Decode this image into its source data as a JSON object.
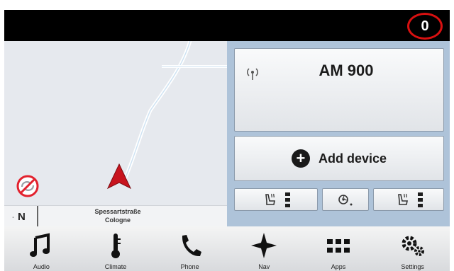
{
  "status_bar": {
    "indicator_value": "0",
    "indicator_color": "#d81010"
  },
  "map": {
    "compass_dot": "·",
    "compass_heading": "N",
    "street_name": "Spessartstraße",
    "city": "Cologne",
    "icons": [
      "no-sync-icon",
      "navigation-arrow-icon"
    ]
  },
  "media": {
    "station": "AM 900",
    "source_icon": "radio-signal-icon"
  },
  "devices": {
    "add_label": "Add device",
    "add_icon": "plus-circle-icon"
  },
  "climate_controls": {
    "left_seat_icon": "heated-seat-icon",
    "middle_icon": "fan-settings-icon",
    "right_seat_icon": "heated-seat-icon"
  },
  "nav": {
    "items": [
      {
        "label": "Audio",
        "icon": "music-note-icon"
      },
      {
        "label": "Climate",
        "icon": "thermometer-icon"
      },
      {
        "label": "Phone",
        "icon": "phone-icon"
      },
      {
        "label": "Nav",
        "icon": "compass-star-icon"
      },
      {
        "label": "Apps",
        "icon": "apps-grid-icon"
      },
      {
        "label": "Settings",
        "icon": "gears-icon"
      }
    ]
  },
  "colors": {
    "panel_background": "#aec3d9",
    "map_background": "#e6e9ee",
    "nav_arrow": "#c8141e"
  }
}
